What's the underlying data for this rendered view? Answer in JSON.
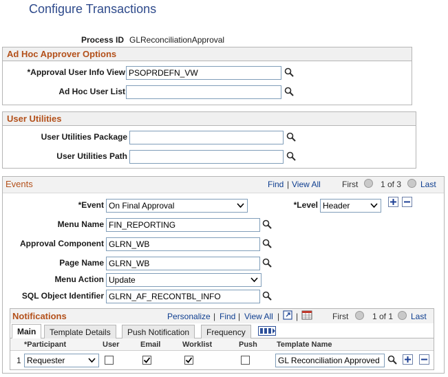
{
  "page": {
    "title": "Configure Transactions"
  },
  "process": {
    "label": "Process ID",
    "value": "GLReconciliationApproval"
  },
  "adhoc": {
    "title": "Ad Hoc Approver Options",
    "user_info_view_label": "*Approval User Info View",
    "user_info_view_value": "PSOPRDEFN_VW",
    "user_list_label": "Ad Hoc User List",
    "user_list_value": ""
  },
  "utilities": {
    "title": "User Utilities",
    "package_label": "User Utilities Package",
    "package_value": "",
    "path_label": "User Utilities Path",
    "path_value": ""
  },
  "events": {
    "title": "Events",
    "find": "Find",
    "sep": "|",
    "view_all": "View All",
    "first": "First",
    "pager": "1 of 3",
    "last": "Last",
    "event_label": "*Event",
    "event_value": "On Final Approval",
    "level_label": "*Level",
    "level_value": "Header",
    "menu_name_label": "Menu Name",
    "menu_name_value": "FIN_REPORTING",
    "component_label": "Approval Component",
    "component_value": "GLRN_WB",
    "page_name_label": "Page Name",
    "page_name_value": "GLRN_WB",
    "menu_action_label": "Menu Action",
    "menu_action_value": "Update",
    "sql_label": "SQL Object Identifier",
    "sql_value": "GLRN_AF_RECONTBL_INFO"
  },
  "notifications": {
    "title": "Notifications",
    "personalize": "Personalize",
    "find": "Find",
    "view_all": "View All",
    "sep": "|",
    "first": "First",
    "pager": "1 of 1",
    "last": "Last",
    "tabs": [
      "Main",
      "Template Details",
      "Push Notification",
      "Frequency"
    ],
    "columns": [
      "*Participant",
      "User",
      "Email",
      "Worklist",
      "Push",
      "Template Name"
    ],
    "row": {
      "num": "1",
      "participant": "Requester",
      "user": false,
      "email": true,
      "worklist": true,
      "push": false,
      "template": "GL Reconciliation Approved"
    }
  }
}
